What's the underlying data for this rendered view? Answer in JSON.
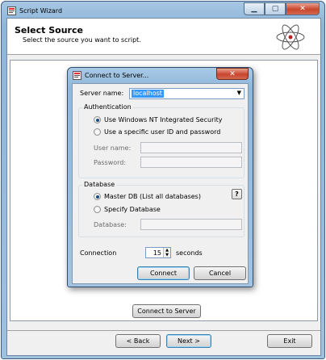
{
  "window": {
    "title": "Script Wizard",
    "controls": {
      "minimize": "▁",
      "maximize": "▢",
      "close": "✕"
    }
  },
  "header": {
    "title": "Select Source",
    "subtitle": "Select the source you want to script."
  },
  "main": {
    "connect_button": "Connect to Server"
  },
  "footer": {
    "back": "< Back",
    "next": "Next >",
    "exit": "Exit"
  },
  "dialog": {
    "title": "Connect to Server...",
    "close": "✕",
    "server_name_label": "Server name:",
    "server_name_value": "localhost",
    "authentication": {
      "legend": "Authentication",
      "option_windows": "Use Windows NT Integrated Security",
      "option_user": "Use a specific user ID and password",
      "selected": "Use Windows NT Integrated Security",
      "user_name_label": "User name:",
      "password_label": "Password:"
    },
    "database": {
      "legend": "Database",
      "option_master": "Master DB (List all databases)",
      "option_specify": "Specify Database",
      "selected": "Master DB (List all databases)",
      "database_label": "Database:",
      "help": "?"
    },
    "connection": {
      "label": "Connection",
      "value": "15",
      "unit": "seconds"
    },
    "connect": "Connect",
    "cancel": "Cancel"
  },
  "colors": {
    "title_bar": "#a7c7e4",
    "close_button": "#c9452d",
    "selection": "#3399ff",
    "client_bg": "#f0f0f0"
  },
  "icons": {
    "window_icon": "app-icon",
    "header_graphic": "atom-icon",
    "dialog_icon": "app-icon"
  }
}
